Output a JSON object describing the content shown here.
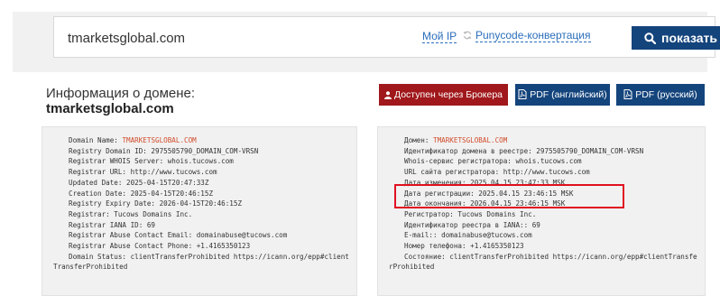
{
  "search": {
    "query": "tmarketsglobal.com",
    "my_ip_label": "Мой IP",
    "punycode_label": "Punycode-конвертация",
    "show_button_label": "показать"
  },
  "info": {
    "title": "Информация о домене:",
    "domain": "tmarketsglobal.com"
  },
  "buttons": {
    "broker": "Доступен через Брокера",
    "pdf_en": "PDF (английский)",
    "pdf_ru": "PDF (русский)"
  },
  "whois_en": {
    "lines": [
      {
        "label": "Domain Name: ",
        "value": "TMARKETSGLOBAL.COM"
      },
      {
        "text": "Registry Domain ID: 2975505790_DOMAIN_COM-VRSN"
      },
      {
        "text": "Registrar WHOIS Server: whois.tucows.com"
      },
      {
        "text": "Registrar URL: http://www.tucows.com"
      },
      {
        "text": "Updated Date: 2025-04-15T20:47:33Z"
      },
      {
        "text": "Creation Date: 2025-04-15T20:46:15Z"
      },
      {
        "text": "Registry Expiry Date: 2026-04-15T20:46:15Z"
      },
      {
        "text": "Registrar: Tucows Domains Inc."
      },
      {
        "text": "Registrar IANA ID: 69"
      },
      {
        "text": "Registrar Abuse Contact Email: domainabuse@tucows.com"
      },
      {
        "text": "Registrar Abuse Contact Phone: +1.4165350123"
      },
      {
        "text": "Domain Status: clientTransferProhibited https://icann.org/epp#clientTransferProhibited"
      }
    ]
  },
  "whois_ru": {
    "lines": [
      {
        "label": "Домен: ",
        "value": "TMARKETSGLOBAL.COM"
      },
      {
        "text": "Идентификатор домена в реестре: 2975505790_DOMAIN_COM-VRSN"
      },
      {
        "text": "Whois-сервис регистратора: whois.tucows.com"
      },
      {
        "text": "URL сайта регистратора: http://www.tucows.com"
      },
      {
        "text": "Дата изменения: 2025.04.15 23:47:33 MSK"
      },
      {
        "text": "Дата регистрации: 2025.04.15 23:46:15 MSK"
      },
      {
        "text": "Дата окончания: 2026.04.15 23:46:15 MSK"
      },
      {
        "text": "Регистратор: Tucows Domains Inc."
      },
      {
        "text": "Идентификатор реестра в IANA:: 69"
      },
      {
        "text": "E-mail:: domainabuse@tucows.com"
      },
      {
        "text": "Номер телефона: +1.4165350123"
      },
      {
        "text": "Состояние: clientTransferProhibited https://icann.org/epp#clientTransferProhibited"
      }
    ]
  },
  "colors": {
    "primary_button": "#14447c",
    "broker_button": "#a0181b",
    "domain_highlight": "#d14c2c",
    "annotation_box": "#e01020",
    "link": "#2a6ebb"
  },
  "icons": {
    "sync": "sync-icon",
    "search": "search-icon",
    "user": "user-icon",
    "pdf": "pdf-icon"
  }
}
